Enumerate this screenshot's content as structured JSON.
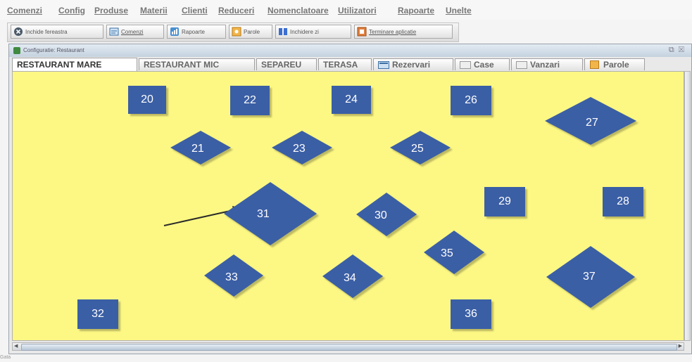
{
  "menu": [
    "Comenzi",
    "Config",
    "Produse",
    "Materii",
    "Clienti",
    "Reduceri",
    "Nomenclatoare",
    "Utilizatori",
    "Rapoarte",
    "Unelte"
  ],
  "toolbar": [
    {
      "label": "Inchide fereastra",
      "icon": "close-circle-icon"
    },
    {
      "label": "Comenzi",
      "icon": "orders-icon"
    },
    {
      "label": "Rapoarte",
      "icon": "reports-icon"
    },
    {
      "label": "Parole",
      "icon": "password-icon"
    },
    {
      "label": "Inchidere zi",
      "icon": "close-day-icon"
    },
    {
      "label": "Terminare aplicatie",
      "icon": "exit-app-icon"
    }
  ],
  "window": {
    "title": "Configuratie: Restaurant"
  },
  "tabs": [
    {
      "label": "RESTAURANT MARE",
      "active": true
    },
    {
      "label": "RESTAURANT MIC"
    },
    {
      "label": "SEPAREU"
    },
    {
      "label": "TERASA"
    },
    {
      "label": "Rezervari",
      "icon": "reservations-icon"
    },
    {
      "label": "Case",
      "icon": "cash-register-icon"
    },
    {
      "label": "Vanzari",
      "icon": "sales-icon"
    },
    {
      "label": "Parole",
      "icon": "password-icon"
    }
  ],
  "tables": [
    {
      "label": "20",
      "shape": "square"
    },
    {
      "label": "22",
      "shape": "square"
    },
    {
      "label": "24",
      "shape": "square"
    },
    {
      "label": "26",
      "shape": "square"
    },
    {
      "label": "27",
      "shape": "diamond"
    },
    {
      "label": "21",
      "shape": "diamond"
    },
    {
      "label": "23",
      "shape": "diamond"
    },
    {
      "label": "25",
      "shape": "diamond"
    },
    {
      "label": "29",
      "shape": "square"
    },
    {
      "label": "28",
      "shape": "square"
    },
    {
      "label": "31",
      "shape": "diamond"
    },
    {
      "label": "30",
      "shape": "diamond"
    },
    {
      "label": "35",
      "shape": "diamond"
    },
    {
      "label": "33",
      "shape": "diamond"
    },
    {
      "label": "34",
      "shape": "diamond"
    },
    {
      "label": "37",
      "shape": "diamond"
    },
    {
      "label": "32",
      "shape": "square"
    },
    {
      "label": "36",
      "shape": "square"
    }
  ],
  "status": "Gata",
  "colors": {
    "canvas": "#fdf883",
    "table": "#3b5fa5",
    "table_text": "#ffffff"
  }
}
